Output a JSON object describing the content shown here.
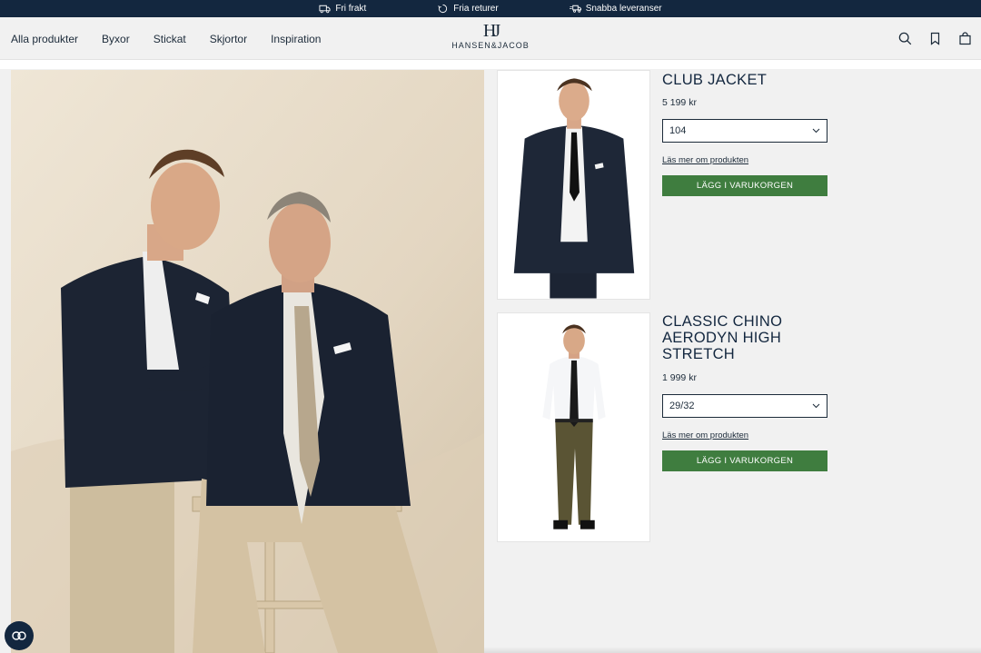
{
  "promo": {
    "items": [
      {
        "label": "Fri frakt",
        "icon": "truck-icon"
      },
      {
        "label": "Fria returer",
        "icon": "return-icon"
      },
      {
        "label": "Snabba leveranser",
        "icon": "fast-delivery-icon"
      }
    ]
  },
  "nav": {
    "items": [
      "Alla produkter",
      "Byxor",
      "Stickat",
      "Skjortor",
      "Inspiration"
    ]
  },
  "logo": {
    "monogram": "HJ",
    "text": "HANSEN&JACOB"
  },
  "header_icons": [
    "search-icon",
    "bookmark-icon",
    "shopping-bag-icon"
  ],
  "products": [
    {
      "title": "CLUB JACKET",
      "price": "5 199 kr",
      "size": "104",
      "read_more": "Läs mer om produkten",
      "button": "LÄGG I VARUKORGEN"
    },
    {
      "title": "CLASSIC CHINO AERODYN HIGH STRETCH",
      "price": "1 999 kr",
      "size": "29/32",
      "read_more": "Läs mer om produkten",
      "button": "LÄGG I VARUKORGEN"
    }
  ],
  "colors": {
    "navy": "#13273f",
    "button_green": "#3f7d3f",
    "background": "#f1f1f1"
  }
}
